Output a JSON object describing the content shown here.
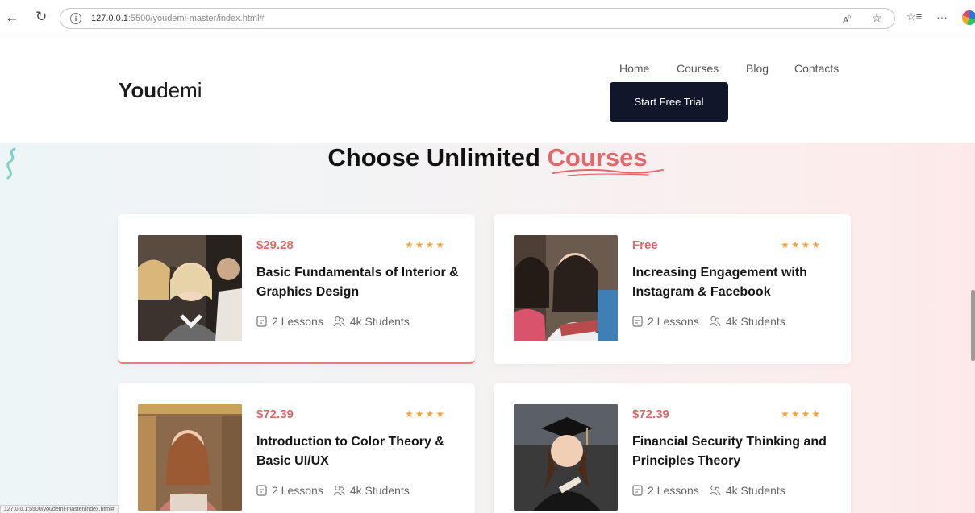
{
  "browser": {
    "url_host": "127.0.0.1",
    "url_path": ":5500/youdemi-master/index.html#",
    "status_url": "127.0.0.1:5500/youdemi-master/index.html#"
  },
  "header": {
    "logo_bold": "You",
    "logo_light": "demi",
    "nav": [
      "Home",
      "Courses",
      "Blog",
      "Contacts"
    ],
    "cta": "Start Free Trial"
  },
  "section": {
    "title_plain": "Choose Unlimited ",
    "title_accent": "Courses"
  },
  "courses": [
    {
      "price": "$29.28",
      "stars": "★★★★",
      "title": "Basic Fundamentals of Interior & Graphics Design",
      "lessons": "2 Lessons",
      "students": "4k Students"
    },
    {
      "price": "Free",
      "stars": "★★★★",
      "title": "Increasing Engagement with Instagram & Facebook",
      "lessons": "2 Lessons",
      "students": "4k Students"
    },
    {
      "price": "$72.39",
      "stars": "★★★★",
      "title": "Introduction to Color Theory & Basic UI/UX",
      "lessons": "2 Lessons",
      "students": "4k Students"
    },
    {
      "price": "$72.39",
      "stars": "★★★★",
      "title": "Financial Security Thinking and Principles Theory",
      "lessons": "2 Lessons",
      "students": "4k Students"
    }
  ],
  "colors": {
    "accent": "#e0686b",
    "dark": "#10172a",
    "star": "#f3a33a"
  }
}
